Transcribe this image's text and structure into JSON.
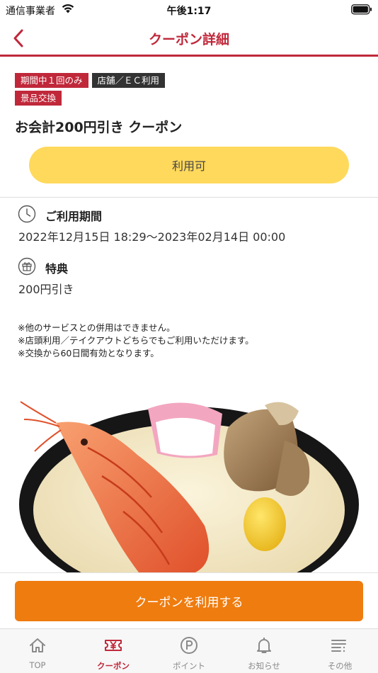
{
  "status_bar": {
    "carrier": "通信事業者",
    "time": "午後1:17"
  },
  "nav": {
    "title": "クーポン詳細"
  },
  "tags": [
    "期間中１回のみ",
    "店舗／ＥＣ利用",
    "景品交換"
  ],
  "coupon": {
    "title": "お会計200円引き クーポン",
    "status": "利用可",
    "period_label": "ご利用期間",
    "period_value": "2022年12月15日 18:29～2023年02月14日 00:00",
    "benefit_label": "特典",
    "benefit_value": "200円引き",
    "notes": [
      "※他のサービスとの併用はできません。",
      "※店頭利用／テイクアウトどちらでもご利用いただけます。",
      "※交換から60日間有効となります。"
    ]
  },
  "action": {
    "use_label": "クーポンを利用する"
  },
  "tabs": [
    {
      "label": "TOP",
      "icon": "home-icon"
    },
    {
      "label": "クーポン",
      "icon": "coupon-icon"
    },
    {
      "label": "ポイント",
      "icon": "point-icon"
    },
    {
      "label": "お知らせ",
      "icon": "bell-icon"
    },
    {
      "label": "その他",
      "icon": "menu-icon"
    }
  ],
  "colors": {
    "brand": "#c0283a",
    "accent_orange": "#ef7c0f",
    "status_yellow": "#ffd95c",
    "tag_dark": "#333333"
  }
}
